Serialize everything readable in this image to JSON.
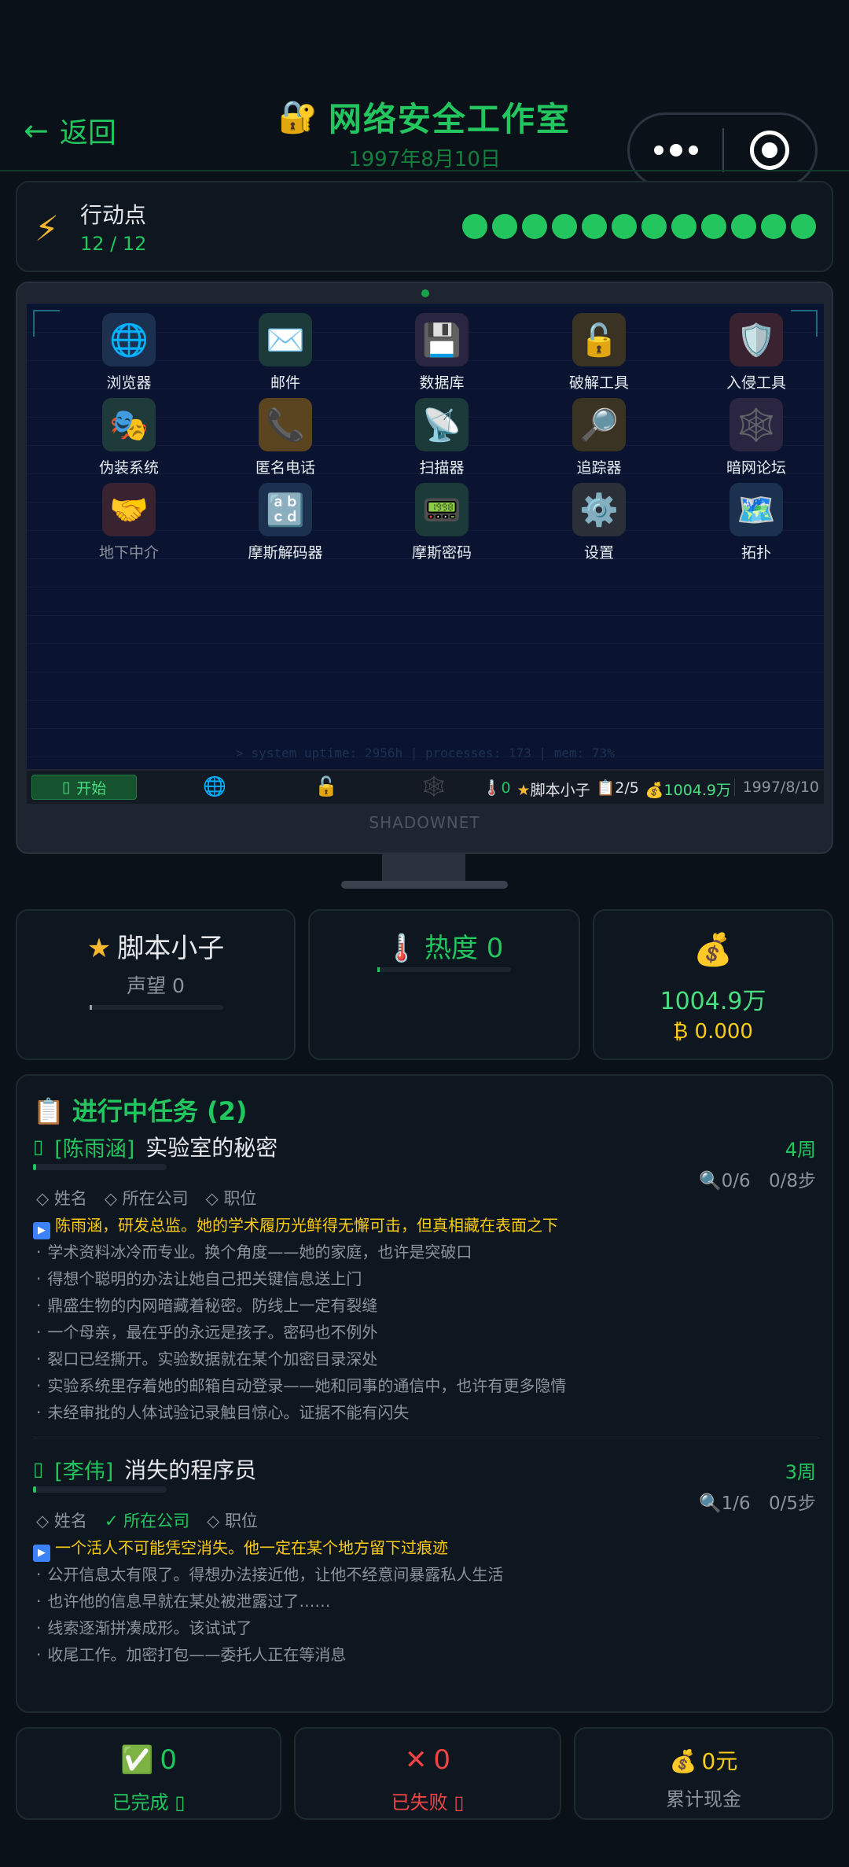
{
  "header": {
    "back_label": "返回",
    "title": "网络安全工作室",
    "date": "1997年8月10日"
  },
  "action_points": {
    "label": "行动点",
    "value": "12 / 12",
    "current": 12,
    "max": 12
  },
  "desktop": {
    "apps": [
      {
        "label": "浏览器",
        "icon": "globe-icon",
        "glyph": "🌐",
        "bg": "#1c3150"
      },
      {
        "label": "邮件",
        "icon": "mail-icon",
        "glyph": "✉️",
        "bg": "#1c3a3a"
      },
      {
        "label": "数据库",
        "icon": "database-icon",
        "glyph": "💾",
        "bg": "#2a2540"
      },
      {
        "label": "破解工具",
        "icon": "lock-icon",
        "glyph": "🔓",
        "bg": "#3a3324"
      },
      {
        "label": "入侵工具",
        "icon": "shield-icon",
        "glyph": "🛡️",
        "bg": "#3a2330"
      },
      {
        "label": "伪装系统",
        "icon": "masks-icon",
        "glyph": "🎭",
        "bg": "#1e3a3a"
      },
      {
        "label": "匿名电话",
        "icon": "phone-icon",
        "glyph": "📞",
        "bg": "#5a4520"
      },
      {
        "label": "扫描器",
        "icon": "satellite-icon",
        "glyph": "📡",
        "bg": "#1c3a3a"
      },
      {
        "label": "追踪器",
        "icon": "magnifier-icon",
        "glyph": "🔎",
        "bg": "#3a3324"
      },
      {
        "label": "暗网论坛",
        "icon": "spiderweb-icon",
        "glyph": "🕸️",
        "bg": "#2a2540"
      },
      {
        "label": "地下中介",
        "icon": "handshake-icon",
        "glyph": "🤝",
        "bg": "#3a2330",
        "dim": true
      },
      {
        "label": "摩斯解码器",
        "icon": "abcd-icon",
        "glyph": "🔡",
        "bg": "#1c3150"
      },
      {
        "label": "摩斯密码",
        "icon": "pager-icon",
        "glyph": "📟",
        "bg": "#1c3a3a"
      },
      {
        "label": "设置",
        "icon": "gear-icon",
        "glyph": "⚙️",
        "bg": "#2a2f38"
      },
      {
        "label": "拓扑",
        "icon": "map-icon",
        "glyph": "🗺️",
        "bg": "#1c3150"
      }
    ],
    "uptime": "> system uptime: 2956h | processes: 173 | mem: 73%",
    "brand": "SHADOWNET"
  },
  "taskbar": {
    "start_label": "开始",
    "heat": "0",
    "rank": "脚本小子",
    "tasks": "2/5",
    "money": "1004.9万",
    "date": "1997/8/10"
  },
  "stats": {
    "rank": "脚本小子",
    "reputation_label": "声望 0",
    "heat_label": "热度 0",
    "money": "1004.9万",
    "btc": "₿ 0.000"
  },
  "tasks": {
    "title": "进行中任务 (2)",
    "items": [
      {
        "client": "[陈雨涵]",
        "name": "实验室的秘密",
        "weeks": "4周",
        "clues": "0/6",
        "steps": "0/8步",
        "tags": [
          "姓名",
          "所在公司",
          "职位"
        ],
        "tag_done": [
          false,
          false,
          false
        ],
        "main_hint": "陈雨涵，研发总监。她的学术履历光鲜得无懈可击，但真相藏在表面之下",
        "hints": [
          "学术资料冰冷而专业。换个角度——她的家庭，也许是突破口",
          "得想个聪明的办法让她自己把关键信息送上门",
          "鼎盛生物的内网暗藏着秘密。防线上一定有裂缝",
          "一个母亲，最在乎的永远是孩子。密码也不例外",
          "裂口已经撕开。实验数据就在某个加密目录深处",
          "实验系统里存着她的邮箱自动登录——她和同事的通信中，也许有更多隐情",
          "未经审批的人体试验记录触目惊心。证据不能有闪失"
        ]
      },
      {
        "client": "[李伟]",
        "name": "消失的程序员",
        "weeks": "3周",
        "clues": "1/6",
        "steps": "0/5步",
        "tags": [
          "姓名",
          "所在公司",
          "职位"
        ],
        "tag_done": [
          false,
          true,
          false
        ],
        "main_hint": "一个活人不可能凭空消失。他一定在某个地方留下过痕迹",
        "hints": [
          "公开信息太有限了。得想办法接近他，让他不经意间暴露私人生活",
          "也许他的信息早就在某处被泄露过了……",
          "线索逐渐拼凑成形。该试试了",
          "收尾工作。加密打包——委托人正在等消息"
        ]
      }
    ]
  },
  "summary": {
    "completed_value": "0",
    "completed_label": "已完成",
    "failed_value": "0",
    "failed_label": "已失败",
    "cash_value": "0元",
    "cash_label": "累计现金"
  },
  "colors": {
    "accent": "#22c55e",
    "warning": "#facc15",
    "danger": "#ef4444",
    "background": "#0b1119"
  }
}
